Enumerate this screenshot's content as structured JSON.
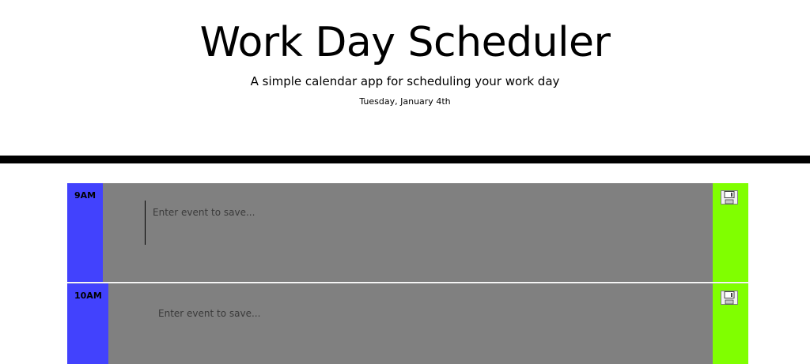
{
  "header": {
    "title": "Work Day Scheduler",
    "subtitle": "A simple calendar app for scheduling your work day",
    "date": "Tuesday, January 4th"
  },
  "schedule": {
    "rows": [
      {
        "hour": "9AM",
        "placeholder": "Enter event to save...",
        "value": ""
      },
      {
        "hour": "10AM",
        "placeholder": "Enter event to save...",
        "value": ""
      }
    ],
    "save_icon": "floppy-disk-icon"
  },
  "colors": {
    "hour_block": "#4242fd",
    "event_present": "#808080",
    "save_button": "#80ff00",
    "divider": "#000000"
  }
}
